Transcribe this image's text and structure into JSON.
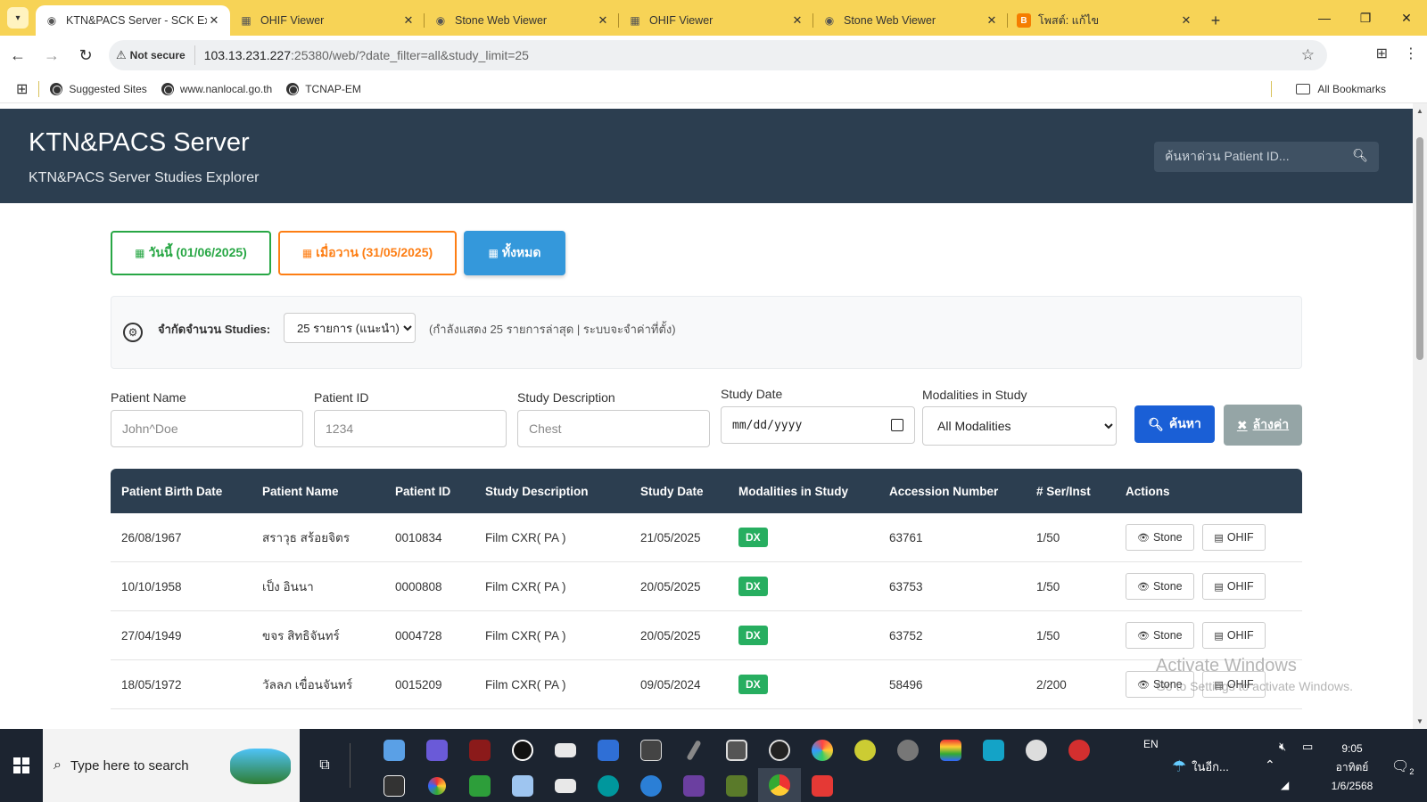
{
  "browser": {
    "tabs": [
      {
        "title": "KTN&PACS Server - SCK Expl",
        "active": true,
        "icon": "globe-icon"
      },
      {
        "title": "OHIF Viewer",
        "active": false,
        "icon": "grid-icon"
      },
      {
        "title": "Stone Web Viewer",
        "active": false,
        "icon": "globe-icon"
      },
      {
        "title": "OHIF Viewer",
        "active": false,
        "icon": "grid-icon"
      },
      {
        "title": "Stone Web Viewer",
        "active": false,
        "icon": "globe-icon"
      },
      {
        "title": "โพสต์: แก้ไข",
        "active": false,
        "icon": "blogger-icon"
      }
    ],
    "security_label": "Not secure",
    "url_host": "103.13.231.227",
    "url_rest": ":25380/web/?date_filter=all&study_limit=25",
    "bookmarks": [
      "Suggested Sites",
      "www.nanlocal.go.th",
      "TCNAP-EM"
    ],
    "all_bookmarks": "All Bookmarks"
  },
  "header": {
    "title": "KTN&PACS Server",
    "subtitle": "KTN&PACS Server Studies Explorer",
    "quick_search_placeholder": "ค้นหาด่วน Patient ID..."
  },
  "date_buttons": {
    "today": "วันนี้ (01/06/2025)",
    "yesterday": "เมื่อวาน (31/05/2025)",
    "all": "ทั้งหมด"
  },
  "limit": {
    "label": "จำกัดจำนวน Studies:",
    "selected": "25 รายการ (แนะนำ)",
    "info": "(กำลังแสดง 25 รายการล่าสุด | ระบบจะจำค่าที่ตั้ง)"
  },
  "filters": {
    "patient_name_label": "Patient Name",
    "patient_name_placeholder": "John^Doe",
    "patient_id_label": "Patient ID",
    "patient_id_placeholder": "1234",
    "study_desc_label": "Study Description",
    "study_desc_placeholder": "Chest",
    "study_date_label": "Study Date",
    "study_date_value": "mm/dd/yyyy",
    "modalities_label": "Modalities in Study",
    "modalities_selected": "All Modalities",
    "search_button": "ค้นหา",
    "clear_button": "ล้างค่า"
  },
  "table": {
    "headers": [
      "Patient Birth Date",
      "Patient Name",
      "Patient ID",
      "Study Description",
      "Study Date",
      "Modalities in Study",
      "Accession Number",
      "# Ser/Inst",
      "Actions"
    ],
    "rows": [
      {
        "birth": "26/08/1967",
        "name": "สราวุธ สร้อยจิตร",
        "pid": "0010834",
        "desc": "Film CXR( PA )",
        "date": "21/05/2025",
        "mod": "DX",
        "acc": "63761",
        "serinst": "1/50"
      },
      {
        "birth": "10/10/1958",
        "name": "เป็ง อินนา",
        "pid": "0000808",
        "desc": "Film CXR( PA )",
        "date": "20/05/2025",
        "mod": "DX",
        "acc": "63753",
        "serinst": "1/50"
      },
      {
        "birth": "27/04/1949",
        "name": "ขจร สิทธิจันทร์",
        "pid": "0004728",
        "desc": "Film CXR( PA )",
        "date": "20/05/2025",
        "mod": "DX",
        "acc": "63752",
        "serinst": "1/50"
      },
      {
        "birth": "18/05/1972",
        "name": "วัลลภ เขื่อนจันทร์",
        "pid": "0015209",
        "desc": "Film CXR( PA )",
        "date": "09/05/2024",
        "mod": "DX",
        "acc": "58496",
        "serinst": "2/200"
      }
    ],
    "action_stone": "Stone",
    "action_ohif": "OHIF"
  },
  "watermark": {
    "line1": "Activate Windows",
    "line2": "Go to Settings to activate Windows."
  },
  "taskbar": {
    "search_placeholder": "Type here to search",
    "lang": "EN",
    "weather": "ในอีก...",
    "time": "9:05",
    "day": "อาทิตย์",
    "date": "1/6/2568",
    "notifications": "2"
  },
  "colors": {
    "header_bg": "#2c3e50",
    "today": "#28a745",
    "yesterday": "#fd7e14",
    "all": "#3498db",
    "search": "#1a5fd6",
    "clear": "#95a5a6",
    "badge": "#27ae60",
    "tabstrip": "#f7d356"
  }
}
